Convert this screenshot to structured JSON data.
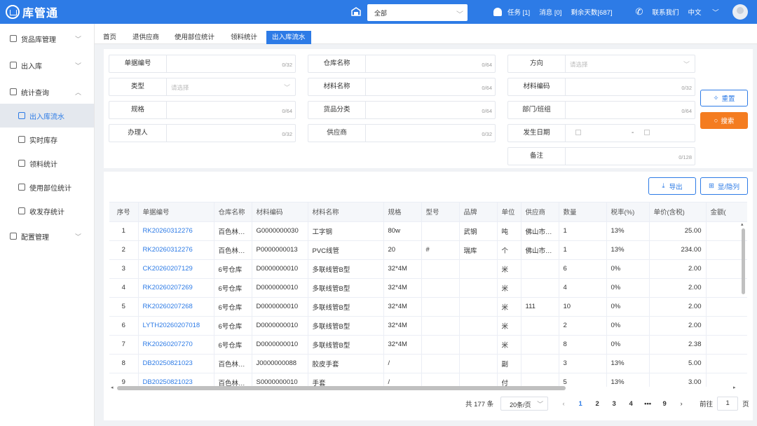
{
  "header": {
    "app_title": "库管通",
    "warehouse_select": "全部",
    "tasks": "任务 [1]",
    "messages": "消息 [0]",
    "remaining_days": "剩余天数[687]",
    "contact": "联系我们",
    "language": "中文",
    "accent_color": "#2d7be6"
  },
  "sidebar": {
    "items": [
      {
        "label": "货品库管理",
        "icon": "goods-icon"
      },
      {
        "label": "出入库",
        "icon": "inout-icon"
      },
      {
        "label": "统计查询",
        "icon": "stats-icon"
      },
      {
        "label": "出入库流水",
        "icon": "flow-icon"
      },
      {
        "label": "实时库存",
        "icon": "stock-icon"
      },
      {
        "label": "领料统计",
        "icon": "pick-icon"
      },
      {
        "label": "使用部位统计",
        "icon": "usage-icon"
      },
      {
        "label": "收发存统计",
        "icon": "sendstore-icon"
      },
      {
        "label": "配置管理",
        "icon": "config-icon"
      }
    ]
  },
  "tabs": [
    "首页",
    "退供应商",
    "使用部位统计",
    "领料统计",
    "出入库流水"
  ],
  "filters": {
    "doc_no": {
      "label": "单据编号",
      "count": "0/32"
    },
    "warehouse_name": {
      "label": "仓库名称",
      "count": "0/64"
    },
    "direction": {
      "label": "方向",
      "placeholder": "请选择"
    },
    "type": {
      "label": "类型",
      "placeholder": "请选择"
    },
    "material_name": {
      "label": "材料名称",
      "count": "0/64"
    },
    "material_code": {
      "label": "材料编码",
      "count": "0/32"
    },
    "spec": {
      "label": "规格",
      "count": "0/64"
    },
    "goods_category": {
      "label": "货品分类",
      "count": "0/64"
    },
    "department": {
      "label": "部门/班组",
      "count": "0/64"
    },
    "handler": {
      "label": "办理人",
      "count": "0/32"
    },
    "supplier": {
      "label": "供应商",
      "count": "0/32"
    },
    "date": {
      "label": "发生日期",
      "separator": "-"
    },
    "remark": {
      "label": "备注",
      "count": "0/128"
    }
  },
  "buttons": {
    "reset": "重置",
    "search": "搜索",
    "export": "导出",
    "toggle_columns": "显/隐列",
    "search_color": "#f47c20"
  },
  "table": {
    "columns": [
      "序号",
      "单据编号",
      "仓库名称",
      "材料编码",
      "材料名称",
      "规格",
      "型号",
      "品牌",
      "单位",
      "供应商",
      "数量",
      "税率(%)",
      "单价(含税)",
      "金额("
    ],
    "rows": [
      [
        "1",
        "RK20260312276",
        "百色林…",
        "G0000000030",
        "工字钢",
        "80w",
        "",
        "武钢",
        "吨",
        "佛山市…",
        "1",
        "13%",
        "25.00",
        ""
      ],
      [
        "2",
        "RK20260312276",
        "百色林…",
        "P0000000013",
        "PVC线管",
        "20",
        "#",
        "瑞库",
        "个",
        "佛山市…",
        "1",
        "13%",
        "234.00",
        ""
      ],
      [
        "3",
        "CK20260207129",
        "6号仓库",
        "D0000000010",
        "多联线管B型",
        "32*4M",
        "",
        "",
        "米",
        "",
        "6",
        "0%",
        "2.00",
        ""
      ],
      [
        "4",
        "RK20260207269",
        "6号仓库",
        "D0000000010",
        "多联线管B型",
        "32*4M",
        "",
        "",
        "米",
        "",
        "4",
        "0%",
        "2.00",
        ""
      ],
      [
        "5",
        "RK20260207268",
        "6号仓库",
        "D0000000010",
        "多联线管B型",
        "32*4M",
        "",
        "",
        "米",
        "111",
        "10",
        "0%",
        "2.00",
        ""
      ],
      [
        "6",
        "LYTH20260207018",
        "6号仓库",
        "D0000000010",
        "多联线管B型",
        "32*4M",
        "",
        "",
        "米",
        "",
        "2",
        "0%",
        "2.00",
        ""
      ],
      [
        "7",
        "RK20260207270",
        "6号仓库",
        "D0000000010",
        "多联线管B型",
        "32*4M",
        "",
        "",
        "米",
        "",
        "8",
        "0%",
        "2.38",
        ""
      ],
      [
        "8",
        "DB20250821023",
        "百色林…",
        "J0000000088",
        "胶皮手套",
        "/",
        "",
        "",
        "副",
        "",
        "3",
        "13%",
        "5.00",
        ""
      ],
      [
        "9",
        "DB20250821023",
        "百色林…",
        "S0000000010",
        "手套",
        "/",
        "",
        "",
        "付",
        "",
        "5",
        "13%",
        "3.00",
        ""
      ]
    ]
  },
  "pagination": {
    "total": "共 177 条",
    "page_size": "20条/页",
    "pages": [
      "1",
      "2",
      "3",
      "4"
    ],
    "ellipsis": "•••",
    "last_page": "9",
    "current": "1",
    "goto_label": "前往",
    "goto_value": "1",
    "page_unit": "页"
  }
}
